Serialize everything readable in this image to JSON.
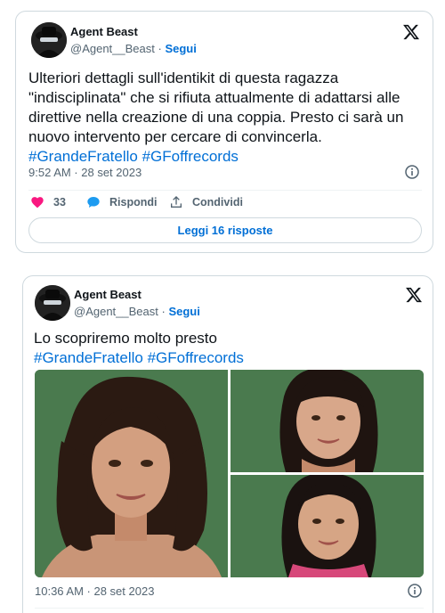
{
  "tweets": [
    {
      "author_name": "Agent Beast",
      "author_handle": "@Agent__Beast",
      "separator": " · ",
      "follow_label": "Segui",
      "text": "Ulteriori dettagli sull'identikit di questa ragazza \"indisciplinata\" che si rifiuta attualmente di adattarsi alle direttive nella creazione di una coppia. Presto ci sarà un nuovo intervento per cercare di convincerla.",
      "hashtags": "#GrandeFratello #GFoffrecords",
      "timestamp": "9:52 AM · 28 set 2023",
      "like_count": "33",
      "reply_label": "Rispondi",
      "share_label": "Condividi",
      "read_replies_label": "Leggi 16 risposte"
    },
    {
      "author_name": "Agent Beast",
      "author_handle": "@Agent__Beast",
      "separator": " · ",
      "follow_label": "Segui",
      "text": "Lo scopriremo molto presto",
      "hashtags": "#GrandeFratello #GFoffrecords",
      "timestamp": "10:36 AM · 28 set 2023"
    }
  ],
  "icons": {
    "x_logo": "x-logo-icon",
    "info": "info-icon",
    "like": "heart-icon",
    "reply": "speech-bubble-icon",
    "share": "share-upload-icon"
  },
  "colors": {
    "link_blue": "#006fd6",
    "like_red": "#f91880",
    "photo_background_green": "#4a7a4e",
    "muted_text": "#536471"
  }
}
